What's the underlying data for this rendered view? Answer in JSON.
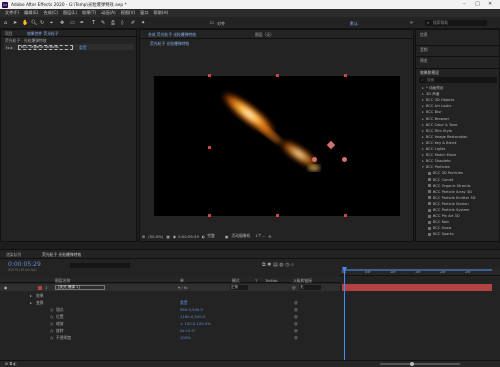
{
  "app": {
    "title": "Adobe After Effects 2020 - G:\\Temp\\光粒爆弹特效.aep *",
    "logo": "Ae"
  },
  "menu": [
    "文件(F)",
    "编辑(E)",
    "合成(C)",
    "图层(L)",
    "效果(T)",
    "动画(A)",
    "视图(V)",
    "窗口",
    "帮助(H)"
  ],
  "toolbar": {
    "snap_label": "对齐",
    "workspace": "默认",
    "search_placeholder": "搜索帮助"
  },
  "project": {
    "tabs": [
      "项目",
      "效果控件 荧光粒子"
    ],
    "breadcrumb": "荧光粒子 · 光粒爆弹特效",
    "effect_row": {
      "name": "BCC Organic Strands",
      "reset": "重置"
    }
  },
  "viewer": {
    "tabs": [
      "合成 荧光粒子 光粒爆弹特效",
      "图层（无）"
    ],
    "subtab": "荧光粒子 光粒爆弹特效",
    "zoom": "(50.0%)",
    "timecode": "0:00:05:29",
    "resolution": "完整",
    "camera": "活动摄像机",
    "views": "1个..."
  },
  "effects_panel": {
    "tabs": [
      "信息",
      "音频",
      "预览",
      "效果和预设"
    ],
    "search_placeholder": "搜索",
    "items": [
      {
        "label": "* 动画预设",
        "level": 0
      },
      {
        "label": "3D 声道",
        "level": 0
      },
      {
        "label": "BCC 3D Objects",
        "level": 0
      },
      {
        "label": "BCC Art Looks",
        "level": 0
      },
      {
        "label": "BCC Blur",
        "level": 0
      },
      {
        "label": "BCC Browser",
        "level": 0
      },
      {
        "label": "BCC Color & Tone",
        "level": 0
      },
      {
        "label": "BCC Film Style",
        "level": 0
      },
      {
        "label": "BCC Image Restoration",
        "level": 0
      },
      {
        "label": "BCC Key & Blend",
        "level": 0
      },
      {
        "label": "BCC Lights",
        "level": 0
      },
      {
        "label": "BCC Match Move",
        "level": 0
      },
      {
        "label": "BCC Obsolete",
        "level": 0
      },
      {
        "label": "BCC Particles",
        "level": 0
      },
      {
        "label": "BCC 3D Particles",
        "level": 1
      },
      {
        "label": "BCC Comet",
        "level": 1
      },
      {
        "label": "BCC Organic Strands",
        "level": 1
      },
      {
        "label": "BCC Particle Array 3D",
        "level": 1
      },
      {
        "label": "BCC Particle Emitter 3D",
        "level": 1
      },
      {
        "label": "BCC Particle Illusion",
        "level": 1
      },
      {
        "label": "BCC Particle System",
        "level": 1
      },
      {
        "label": "BCC Pin Art 3D",
        "level": 1
      },
      {
        "label": "BCC Rain",
        "level": 1
      },
      {
        "label": "BCC Snow",
        "level": 1
      },
      {
        "label": "BCC Sparks",
        "level": 1
      }
    ]
  },
  "timeline": {
    "tabs": [
      "渲染队列",
      "荧光粒子 光粒爆弹特效"
    ],
    "timecode": "0:00:05:29",
    "timecode_sub": "00179 (30.00 fps)",
    "columns": [
      "图层名称",
      "单",
      "模式",
      "T",
      "TrkMat",
      "父级和链接"
    ],
    "layer": {
      "num": "1",
      "name": "[荧光 爆弹 1]",
      "mode": "正常",
      "parent": "无"
    },
    "properties": [
      {
        "label": "效果",
        "value": ""
      },
      {
        "label": "变换",
        "value": "重置"
      },
      {
        "label": "锚点",
        "value": "960.0,540.0"
      },
      {
        "label": "位置",
        "value": "1160.0,540.0"
      },
      {
        "label": "缩放",
        "value": "∞ 100.0,100.0%"
      },
      {
        "label": "旋转",
        "value": "0x+0.0°"
      },
      {
        "label": "不透明度",
        "value": "100%"
      }
    ],
    "ruler": [
      "0s",
      "05f",
      "10f",
      "15f",
      "20f",
      "25f"
    ]
  },
  "colors": {
    "accent_blue": "#5c8edc",
    "layer_red": "#b34242",
    "playhead": "#3e8ef7"
  }
}
